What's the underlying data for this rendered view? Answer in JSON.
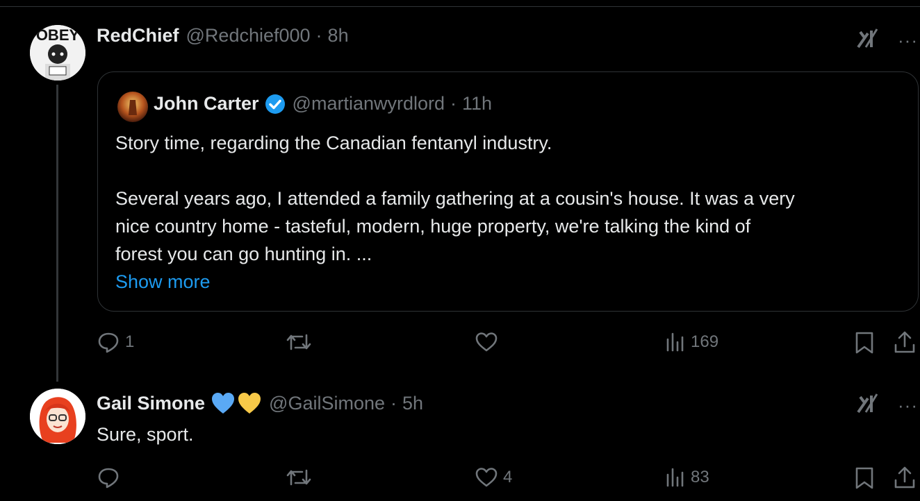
{
  "posts": [
    {
      "display_name": "RedChief",
      "handle": "@Redchief000",
      "time": "8h",
      "avatar_text": "OBEY",
      "quote": {
        "display_name": "John Carter",
        "handle": "@martianwyrdlord",
        "time": "11h",
        "verified": true,
        "lines": [
          "Story time, regarding the Canadian fentanyl industry.",
          "Several years ago, I attended a family gathering at a cousin's house. It was a very",
          "nice country home - tasteful, modern, huge property, we're talking the kind of",
          "forest you can go hunting in. ..."
        ],
        "show_more": "Show more"
      },
      "actions": {
        "replies": "1",
        "reposts": "",
        "likes": "",
        "views": "169"
      }
    },
    {
      "display_name": "Gail Simone",
      "handle": "@GailSimone",
      "time": "5h",
      "badges": [
        "blue-heart",
        "yellow-heart"
      ],
      "text": "Sure, sport.",
      "actions": {
        "replies": "",
        "reposts": "",
        "likes": "4",
        "views": "83"
      }
    }
  ],
  "colors": {
    "background": "#000000",
    "text": "#e7e9ea",
    "secondary": "#71767b",
    "link": "#1d9bf0",
    "verified": "#1d9bf0"
  },
  "overflow_label": "···"
}
